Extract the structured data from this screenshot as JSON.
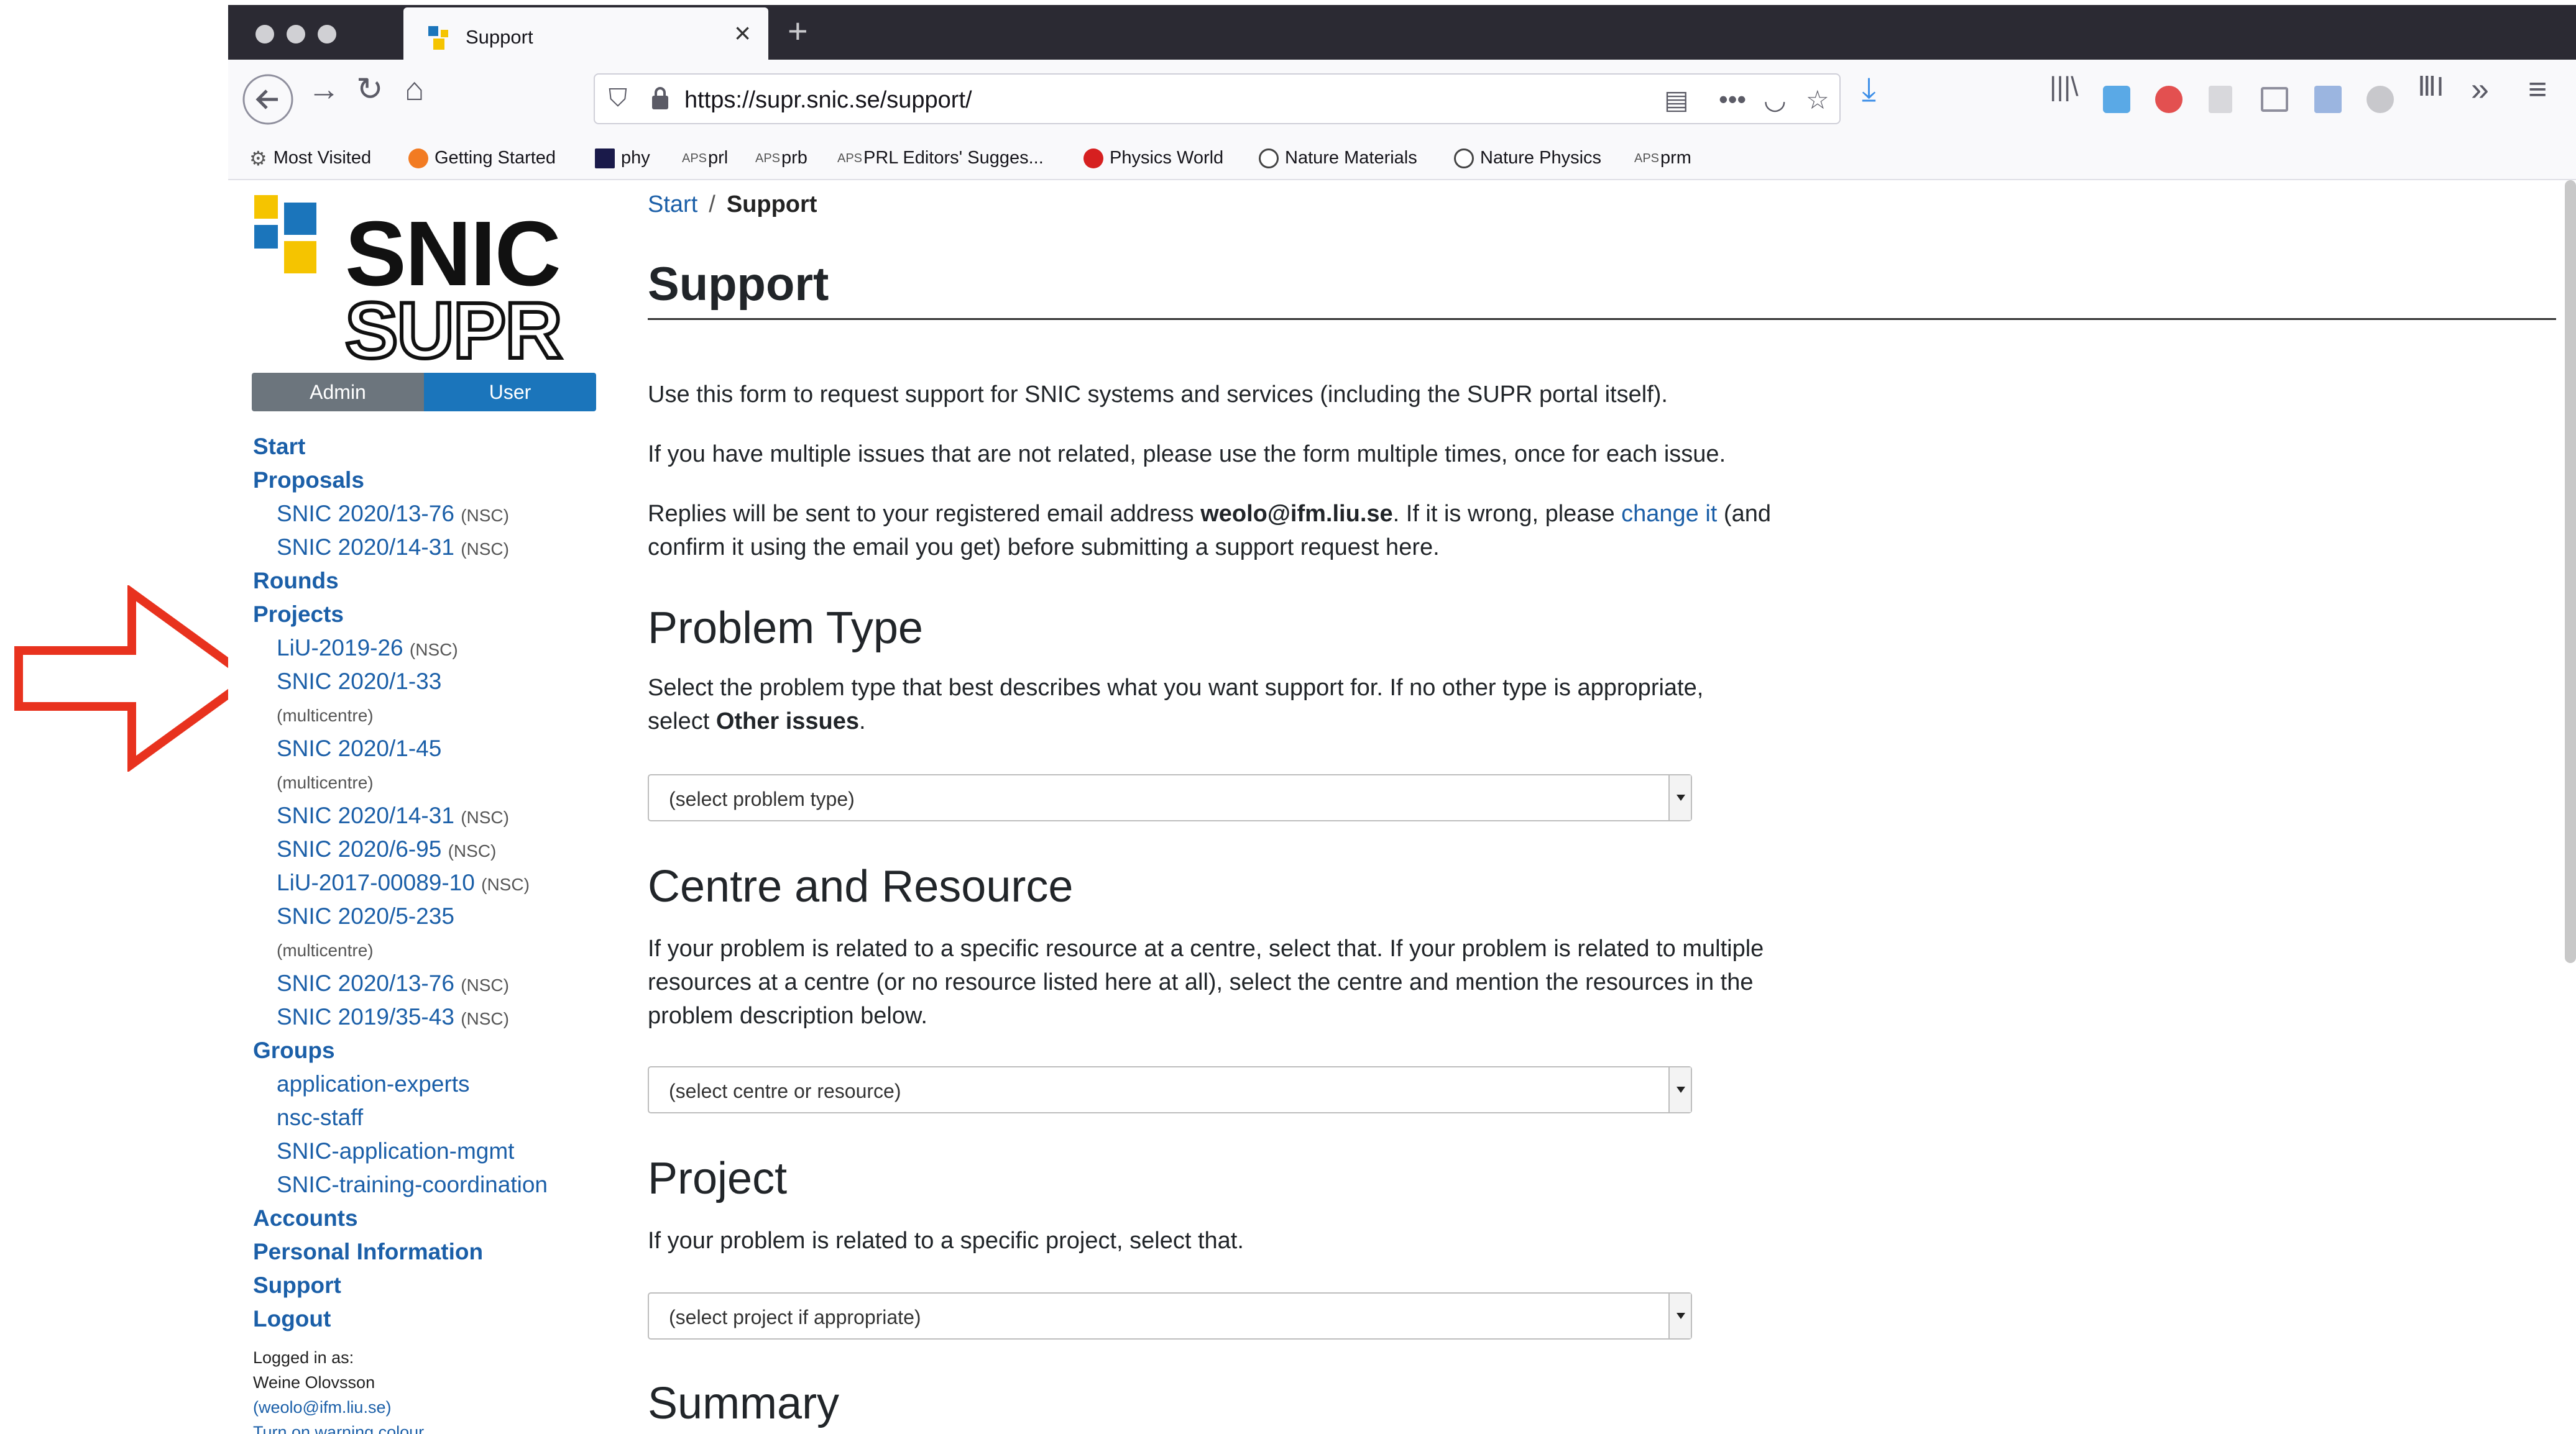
{
  "browser": {
    "tab_title": "Support",
    "url": "https://supr.snic.se/support/",
    "bookmarks": [
      {
        "label": "Most Visited",
        "icon": "gear-icon"
      },
      {
        "label": "Getting Started",
        "icon": "firefox-icon"
      },
      {
        "label": "phy",
        "icon": "bookmark-icon"
      },
      {
        "label": "prl",
        "icon": "aps-icon"
      },
      {
        "label": "prb",
        "icon": "aps-icon"
      },
      {
        "label": "PRL Editors' Sugges...",
        "icon": "aps-icon"
      },
      {
        "label": "Physics World",
        "icon": "red-circle-icon"
      },
      {
        "label": "Nature Materials",
        "icon": "globe-icon"
      },
      {
        "label": "Nature Physics",
        "icon": "globe-icon"
      },
      {
        "label": "prm",
        "icon": "aps-icon"
      }
    ]
  },
  "logo": {
    "line1": "SNIC",
    "line2": "SUPR"
  },
  "mode_toggle": {
    "admin": "Admin",
    "user": "User"
  },
  "sidebar": {
    "start": "Start",
    "proposals": "Proposals",
    "proposal_items": [
      {
        "label": "SNIC 2020/13-76",
        "tag": "(NSC)"
      },
      {
        "label": "SNIC 2020/14-31",
        "tag": "(NSC)"
      }
    ],
    "rounds": "Rounds",
    "projects": "Projects",
    "project_items": [
      {
        "label": "LiU-2019-26",
        "tag": "(NSC)"
      },
      {
        "label": "SNIC 2020/1-33",
        "tag": ""
      },
      {
        "label": "(multicentre)",
        "tag": ""
      },
      {
        "label": "SNIC 2020/1-45",
        "tag": ""
      },
      {
        "label": "(multicentre)",
        "tag": ""
      },
      {
        "label": "SNIC 2020/14-31",
        "tag": "(NSC)"
      },
      {
        "label": "SNIC 2020/6-95",
        "tag": "(NSC)"
      },
      {
        "label": "LiU-2017-00089-10",
        "tag": "(NSC)"
      },
      {
        "label": "SNIC 2020/5-235",
        "tag": ""
      },
      {
        "label": "(multicentre)",
        "tag": ""
      },
      {
        "label": "SNIC 2020/13-76",
        "tag": "(NSC)"
      },
      {
        "label": "SNIC 2019/35-43",
        "tag": "(NSC)"
      }
    ],
    "groups": "Groups",
    "group_items": [
      "application-experts",
      "nsc-staff",
      "SNIC-application-mgmt",
      "SNIC-training-coordination"
    ],
    "accounts": "Accounts",
    "personal_information": "Personal Information",
    "support": "Support",
    "logout": "Logout",
    "logged_in_as": "Logged in as:",
    "user_name": "Weine Olovsson",
    "user_email": "(weolo@ifm.liu.se)",
    "warning_colour": "Turn on warning colour."
  },
  "main": {
    "breadcrumb_start": "Start",
    "breadcrumb_sep": "/",
    "breadcrumb_current": "Support",
    "title": "Support",
    "intro1": "Use this form to request support for SNIC systems and services (including the SUPR portal itself).",
    "intro2": "If you have multiple issues that are not related, please use the form multiple times, once for each issue.",
    "intro3_a": "Replies will be sent to your registered email address ",
    "intro3_email": "weolo@ifm.liu.se",
    "intro3_b": ". If it is wrong, please ",
    "intro3_link": "change it",
    "intro3_c": " (and",
    "intro3_line2": "confirm it using the email you get) before submitting a support request here.",
    "problem_type": {
      "heading": "Problem Type",
      "text1": "Select the problem type that best describes what you want support for. If no other type is appropriate,",
      "text2_a": "select ",
      "text2_b": "Other issues",
      "text2_c": ".",
      "select": "(select problem type)"
    },
    "centre_resource": {
      "heading": "Centre and Resource",
      "text1": "If your problem is related to a specific resource at a centre, select that. If your problem is related to multiple",
      "text2": "resources at a centre (or no resource listed here at all), select the centre and mention the resources in the",
      "text3": "problem description below.",
      "select": "(select centre or resource)"
    },
    "project": {
      "heading": "Project",
      "text1": "If your problem is related to a specific project, select that.",
      "select": "(select project if appropriate)"
    },
    "summary": {
      "heading": "Summary"
    }
  },
  "colors": {
    "link": "#1b5fa8",
    "user_toggle": "#1b75bb",
    "admin_toggle": "#6c757d",
    "arrow": "#e8321e"
  }
}
